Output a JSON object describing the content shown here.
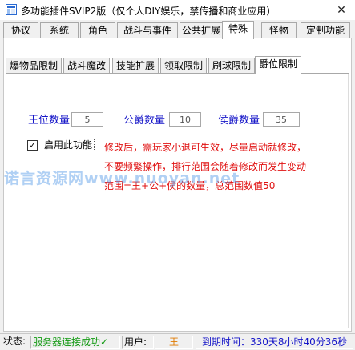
{
  "window": {
    "title": "多功能插件SVIP2版（仅个人DIY娱乐，禁传播和商业应用）",
    "close_glyph": "✕"
  },
  "tabs": [
    {
      "label": "协议"
    },
    {
      "label": "系统"
    },
    {
      "label": "角色"
    },
    {
      "label": "战斗与事件"
    },
    {
      "label": "公共扩展"
    },
    {
      "label": "特殊"
    },
    {
      "label": "怪物"
    },
    {
      "label": "定制功能"
    }
  ],
  "active_tab": "特殊",
  "subtabs": [
    {
      "label": "爆物品限制"
    },
    {
      "label": "战斗魔改"
    },
    {
      "label": "技能扩展"
    },
    {
      "label": "领取限制"
    },
    {
      "label": "刷球限制"
    },
    {
      "label": "爵位限制"
    }
  ],
  "active_subtab": "爵位限制",
  "fields": [
    {
      "label": "王位数量",
      "value": "5"
    },
    {
      "label": "公爵数量",
      "value": "10"
    },
    {
      "label": "侯爵数量",
      "value": "35"
    }
  ],
  "enable_checkbox": {
    "label": "启用此功能",
    "checked": true,
    "mark": "✓"
  },
  "notes": [
    "修改后，需玩家小退可生效，尽量启动就修改，",
    "不要频繁操作，排行范围会随着修改而发生变动",
    "范围=王+公+侯的数量，总范围数值50"
  ],
  "watermark": "诺言资源网www.nuoyan.net",
  "status": {
    "label": "状态:",
    "connection": "服务器连接成功",
    "connection_icon": "✓",
    "user_label": "用户:",
    "user_value": "王",
    "expiry": "到期时间：330天8小时40分36秒"
  },
  "colors": {
    "label_blue": "#1515c8",
    "note_red": "#e01010",
    "status_green": "#119911",
    "user_orange": "#e07a00",
    "expiry_blue": "#1515c8"
  }
}
